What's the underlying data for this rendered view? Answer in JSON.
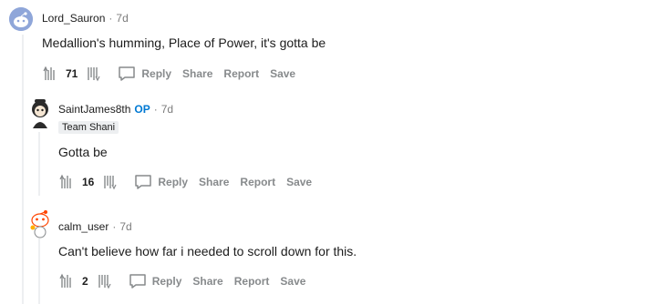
{
  "comments": [
    {
      "author": "Lord_Sauron",
      "sep": "·",
      "time": "7d",
      "text": "Medallion's humming, Place of Power, it's gotta be",
      "score": "71",
      "actions": {
        "reply": "Reply",
        "share": "Share",
        "report": "Report",
        "save": "Save"
      }
    },
    {
      "author": "SaintJames8th",
      "op": "OP",
      "sep": "·",
      "time": "7d",
      "flair": "Team Shani",
      "text": "Gotta be",
      "score": "16",
      "actions": {
        "reply": "Reply",
        "share": "Share",
        "report": "Report",
        "save": "Save"
      }
    },
    {
      "author": "calm_user",
      "sep": "·",
      "time": "7d",
      "text": "Can't believe how far i needed to scroll down for this.",
      "score": "2",
      "actions": {
        "reply": "Reply",
        "share": "Share",
        "report": "Report",
        "save": "Save"
      }
    }
  ],
  "colors": {
    "op": "#0079d3",
    "muted": "#878a8c",
    "thread_line": "#edeff1"
  },
  "icons": {
    "upvote": "upvote-icon",
    "downvote": "downvote-icon",
    "reply": "comment-bubble-icon"
  }
}
